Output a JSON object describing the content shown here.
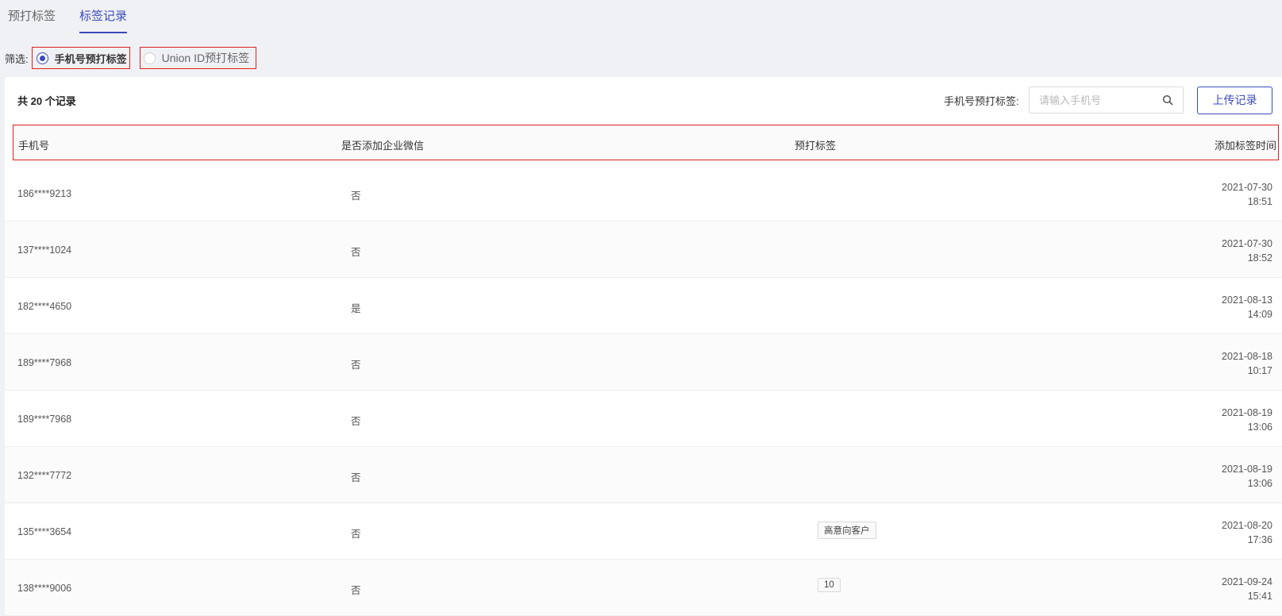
{
  "tabs": [
    {
      "label": "预打标签",
      "active": false
    },
    {
      "label": "标签记录",
      "active": true
    }
  ],
  "filter": {
    "label": "筛选:",
    "options": [
      {
        "label": "手机号预打标签",
        "checked": true
      },
      {
        "label": "Union ID预打标签",
        "checked": false
      }
    ]
  },
  "toolbar": {
    "count_prefix": "共 ",
    "count": "20",
    "count_suffix": " 个记录",
    "search_label": "手机号预打标签:",
    "search_placeholder": "请输入手机号",
    "upload_label": "上传记录"
  },
  "table": {
    "columns": [
      "手机号",
      "是否添加企业微信",
      "预打标签",
      "添加标签时间"
    ],
    "rows": [
      {
        "phone": "186****9213",
        "wx": "否",
        "tag": "",
        "date": "2021-07-30",
        "time": "18:51"
      },
      {
        "phone": "137****1024",
        "wx": "否",
        "tag": "",
        "date": "2021-07-30",
        "time": "18:52"
      },
      {
        "phone": "182****4650",
        "wx": "是",
        "tag": "",
        "date": "2021-08-13",
        "time": "14:09"
      },
      {
        "phone": "189****7968",
        "wx": "否",
        "tag": "",
        "date": "2021-08-18",
        "time": "10:17"
      },
      {
        "phone": "189****7968",
        "wx": "否",
        "tag": "",
        "date": "2021-08-19",
        "time": "13:06"
      },
      {
        "phone": "132****7772",
        "wx": "否",
        "tag": "",
        "date": "2021-08-19",
        "time": "13:06"
      },
      {
        "phone": "135****3654",
        "wx": "否",
        "tag": "高意向客户",
        "date": "2021-08-20",
        "time": "17:36"
      },
      {
        "phone": "138****9006",
        "wx": "否",
        "tag": "10",
        "date": "2021-09-24",
        "time": "15:41"
      }
    ]
  },
  "colors": {
    "accent": "#3a4bb8",
    "highlight_border": "#e02020"
  }
}
